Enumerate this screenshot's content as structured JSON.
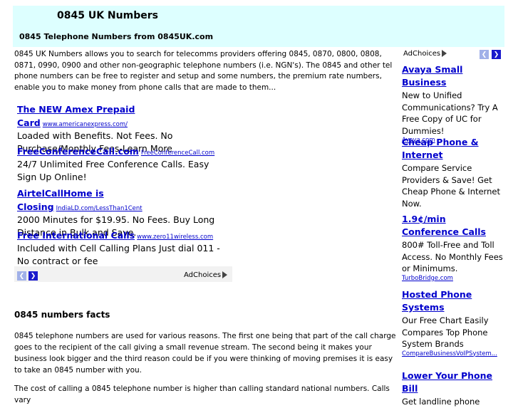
{
  "header": {
    "title": "0845 UK Numbers",
    "subtitle": "0845 Telephone Numbers from 0845UK.com"
  },
  "intro": "0845 UK Numbers allows you to search for telecomms providers offering 0845, 0870, 0800, 0808, 0871, 0990, 0900 and other non-geographic telephone numbers (i.e. NGN's). The 0845 and other tel phone numbers can be free to register and setup and some numbers, the premium rate numbers, enable you to make money from phone calls that are made to them...",
  "ad_left": {
    "items": [
      {
        "title": "The NEW Amex Prepaid Card",
        "url": "www.americanexpress.com/",
        "body": "Loaded with Benefits. Not Fees. No Purchase/Monthly Fees-Learn More"
      },
      {
        "title": "FreeConferenceCall.com",
        "url": "FreeConferenceCall.com",
        "body": "24/7 Unlimited Free Conference Calls. Easy Sign Up Online!"
      },
      {
        "title": "AirtelCallHome is Closing",
        "url": "IndiaLD.com/LessThan1Cent",
        "body": "2000 Minutes for $19.95. No Fees. Buy Long Distance in Bulk and Save."
      },
      {
        "title": "Free International Calls",
        "url": "www.zero11wireless.com",
        "body": "Included with Cell Calling Plans Just dial 011 - No contract or fee"
      }
    ],
    "adchoices": "AdChoices"
  },
  "facts": {
    "heading": "0845 numbers facts",
    "p1": "0845 telephone numbers are used for various reasons. The first one being that part of the call charge goes to the recipient of the call giving a small revenue stream. The second being it makes your business look bigger and the third reason could be if you were thinking of moving premises it is easy to take an 0845 number with you.",
    "p2": "The cost of calling a 0845 telephone number is higher than calling standard national numbers. Calls vary"
  },
  "ad_right": {
    "adchoices": "AdChoices",
    "items": [
      {
        "title": "Avaya Small Business",
        "body": "New to Unified Communications? Try A Free Copy of UC for Dummies!",
        "url": "Avaya.com"
      },
      {
        "title": "Cheap Phone & Internet",
        "body": "Compare Service Providers & Save! Get Cheap Phone & Internet Now.",
        "url": ""
      },
      {
        "title": "1.9¢/min Conference Calls",
        "body": "800# Toll-Free and Toll Access. No Monthly Fees or Minimums.",
        "url": "TurboBridge.com"
      },
      {
        "title": "Hosted Phone Systems",
        "body": "Our Free Chart Easily Compares Top Phone System Brands",
        "url": "CompareBusinessVoIPSystem..."
      },
      {
        "title": "Lower Your Phone Bill",
        "body": "Get landline phone",
        "url": ""
      }
    ]
  },
  "icons": {
    "prev": "chevron-left-icon",
    "next": "chevron-right-icon",
    "adchoices": "adchoices-icon"
  }
}
